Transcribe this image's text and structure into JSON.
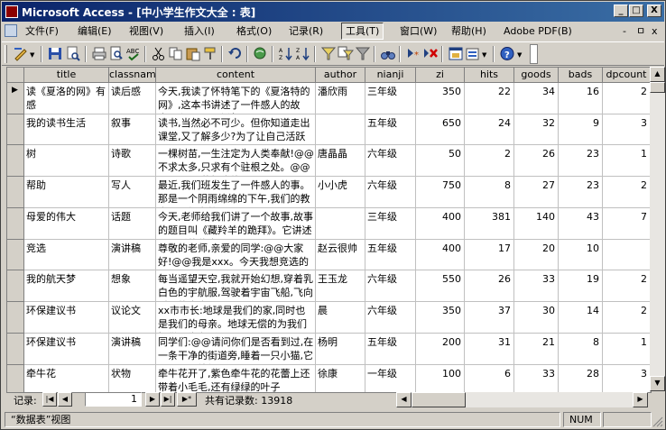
{
  "window": {
    "title": "Microsoft Access - [中小学生作文大全 : 表]",
    "buttons": {
      "minimize": "_",
      "restore": "□",
      "close": "X"
    }
  },
  "menubar": {
    "items": [
      {
        "label": "文件(F)"
      },
      {
        "label": "编辑(E)"
      },
      {
        "label": "视图(V)"
      },
      {
        "label": "插入(I)"
      },
      {
        "label": "格式(O)"
      },
      {
        "label": "记录(R)"
      },
      {
        "label": "工具(T)"
      },
      {
        "label": "窗口(W)"
      },
      {
        "label": "帮助(H)"
      },
      {
        "label": "Adobe PDF(B)"
      }
    ],
    "active_index": 6,
    "mdi_buttons": {
      "minimize": "-",
      "restore": "ㅁ",
      "close": "x"
    }
  },
  "toolbar": {
    "icons": [
      "design-view",
      "save",
      "print",
      "print-preview",
      "spelling",
      "cut",
      "copy",
      "paste",
      "format-painter",
      "undo",
      "insert-hyperlink",
      "sort-ascending",
      "sort-descending",
      "filter-by-selection",
      "filter-by-form",
      "apply-filter",
      "find",
      "new-record",
      "delete-record",
      "database-window",
      "new-object",
      "help"
    ]
  },
  "datasheet": {
    "columns": [
      "title",
      "classname",
      "content",
      "author",
      "nianji",
      "zi",
      "hits",
      "goods",
      "bads",
      "dpcount"
    ],
    "rows": [
      {
        "title": "读《夏洛的网》有感",
        "classname": "读后感",
        "content": "今天,我读了怀特笔下的《夏洛特的网》,这本书讲述了一件感人的故事。主人公是小猪",
        "author": "潘欣雨",
        "nianji": "三年级",
        "zi": "350",
        "hits": "22",
        "goods": "34",
        "bads": "16",
        "dpcount": "2",
        "current": true
      },
      {
        "title": "我的读书生活",
        "classname": "叙事",
        "content": "读书,当然必不可少。但你知道走出课堂,又了解多少?为了让自己活跃在课堂上,我就读书",
        "author": "",
        "nianji": "五年级",
        "zi": "650",
        "hits": "24",
        "goods": "32",
        "bads": "9",
        "dpcount": "3"
      },
      {
        "title": "树",
        "classname": "诗歌",
        "content": "一棵树苗,一生注定为人类奉献!@@不求太多,只求有个驻根之处。@@只是,一颗草籽也能",
        "author": "唐晶晶",
        "nianji": "六年级",
        "zi": "50",
        "hits": "2",
        "goods": "26",
        "bads": "23",
        "dpcount": "1"
      },
      {
        "title": "帮助",
        "classname": "写人",
        "content": "最近,我们班发生了一件感人的事。那是一个阴雨绵绵的下午,我们的教室里显得安静",
        "author": "小小虎",
        "nianji": "六年级",
        "zi": "750",
        "hits": "8",
        "goods": "27",
        "bads": "23",
        "dpcount": "2"
      },
      {
        "title": "母爱的伟大",
        "classname": "话题",
        "content": "今天,老师给我们讲了一个故事,故事的题目叫《藏羚羊的跪拜》。它讲述了母爱的伟大",
        "author": "",
        "nianji": "三年级",
        "zi": "400",
        "hits": "381",
        "goods": "140",
        "bads": "43",
        "dpcount": "7"
      },
      {
        "title": "竞选",
        "classname": "演讲稿",
        "content": "尊敬的老师,亲爱的同学:@@大家好!@@我是xxx。今天我想竞选的是卫生委员。我相信",
        "author": "赵云很帅",
        "nianji": "五年级",
        "zi": "400",
        "hits": "17",
        "goods": "20",
        "bads": "10",
        "dpcount": ""
      },
      {
        "title": "我的航天梦",
        "classname": "想象",
        "content": "每当遥望天空,我就开始幻想,穿着乳白色的宇航服,驾驶着宇宙飞船,飞向遥远的太空",
        "author": "王玉龙",
        "nianji": "六年级",
        "zi": "550",
        "hits": "26",
        "goods": "33",
        "bads": "19",
        "dpcount": "2"
      },
      {
        "title": "环保建议书",
        "classname": "议论文",
        "content": "xx市市长:地球是我们的家,同时也是我们的母亲。地球无偿的为我们提供了生存所需",
        "author": "晨",
        "nianji": "六年级",
        "zi": "350",
        "hits": "37",
        "goods": "30",
        "bads": "14",
        "dpcount": "2"
      },
      {
        "title": "环保建议书",
        "classname": "演讲稿",
        "content": "同学们:@@请问你们是否看到过,在一条干净的街道旁,睡着一只小猫,它周围都是垃圾",
        "author": "杨明",
        "nianji": "五年级",
        "zi": "200",
        "hits": "31",
        "goods": "21",
        "bads": "8",
        "dpcount": "1"
      },
      {
        "title": "牵牛花",
        "classname": "状物",
        "content": "牵牛花开了,紫色牵牛花的花蕾上还带着小毛毛,还有绿绿的叶子",
        "author": "徐康",
        "nianji": "一年级",
        "zi": "100",
        "hits": "6",
        "goods": "33",
        "bads": "28",
        "dpcount": "3"
      }
    ]
  },
  "navigation": {
    "label": "记录:",
    "current_record": "1",
    "total_text": "共有记录数: 13918",
    "first": "|◀",
    "prev": "◀",
    "next": "▶",
    "last": "▶|",
    "new": "▶*"
  },
  "statusbar": {
    "view_label": "“数据表”视图",
    "num_indicator": "NUM"
  },
  "colors": {
    "title_start": "#0a246a",
    "title_end": "#3a6ea5",
    "chrome": "#d4d0c8"
  }
}
